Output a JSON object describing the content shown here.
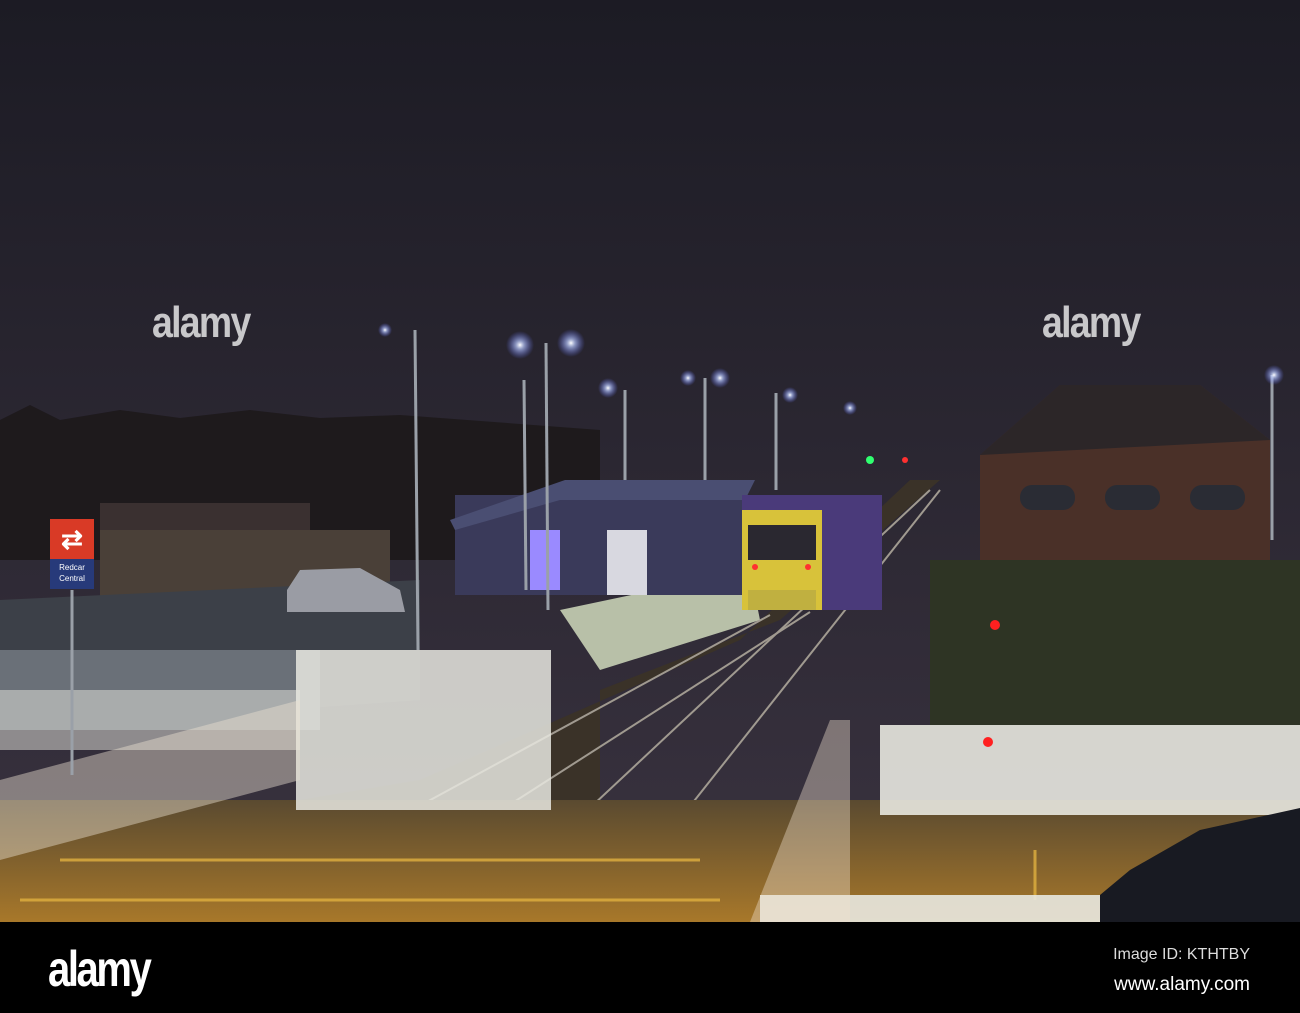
{
  "watermark": {
    "text": "alamy"
  },
  "station_sign": {
    "symbol": "⇄",
    "name_line1": "Redcar",
    "name_line2": "Central"
  },
  "footer": {
    "logo": "alamy",
    "image_id": "Image ID: KTHTBY",
    "url": "www.alamy.com"
  },
  "colors": {
    "sky": "#25232e",
    "platform_light": "#cfd8c8",
    "train_yellow": "#d8c23a",
    "train_purple": "#4a3a7a",
    "road_orange": "#b8822a"
  }
}
